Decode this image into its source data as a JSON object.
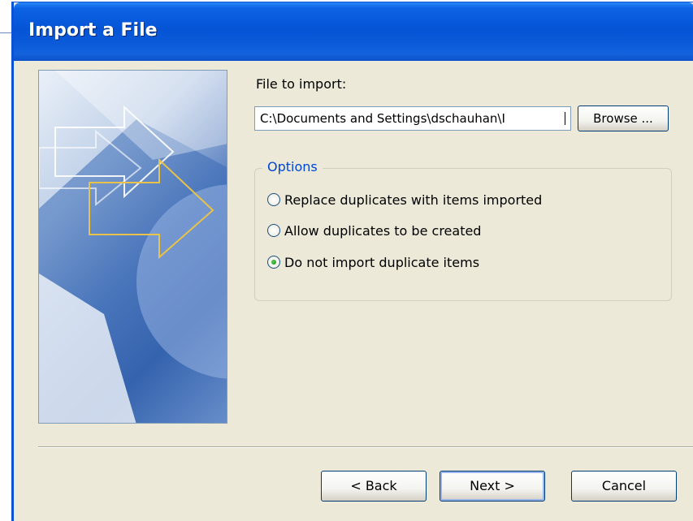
{
  "window": {
    "title": "Import a File"
  },
  "file_section": {
    "label": "File to import:",
    "path_value": "C:\\Documents and Settings\\dschauhan\\I",
    "browse_label": "Browse ..."
  },
  "options": {
    "legend": "Options",
    "choices": [
      {
        "label": "Replace duplicates with items imported",
        "checked": false
      },
      {
        "label": "Allow duplicates to be created",
        "checked": false
      },
      {
        "label": "Do not import duplicate items",
        "checked": true
      }
    ]
  },
  "buttons": {
    "back": "< Back",
    "next": "Next >",
    "cancel": "Cancel"
  },
  "colors": {
    "titlebar": "#0554d6",
    "dialog_bg": "#ece9d8",
    "group_legend": "#0046d5",
    "radio_selected": "#21a121"
  }
}
